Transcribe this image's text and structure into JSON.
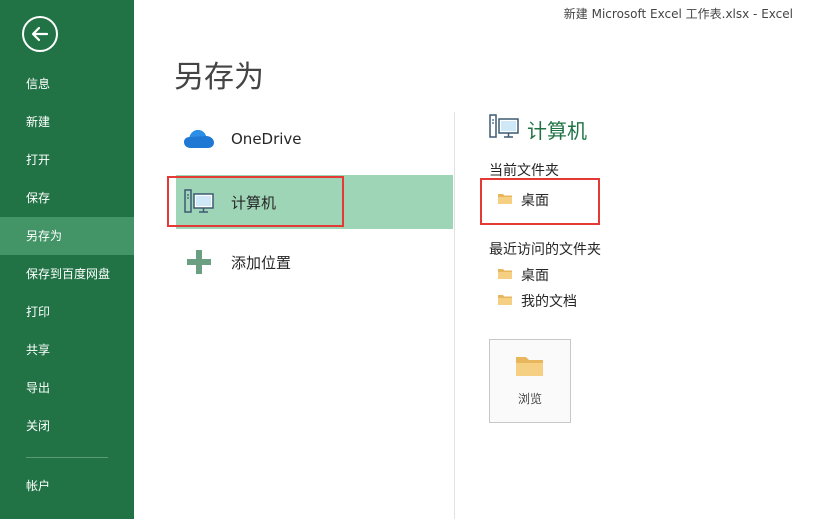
{
  "window": {
    "title": "新建 Microsoft Excel 工作表.xlsx - Excel"
  },
  "sidebar": {
    "back_icon": "back-arrow-icon",
    "items": [
      {
        "label": "信息"
      },
      {
        "label": "新建"
      },
      {
        "label": "打开"
      },
      {
        "label": "保存"
      },
      {
        "label": "另存为",
        "active": true
      },
      {
        "label": "保存到百度网盘"
      },
      {
        "label": "打印"
      },
      {
        "label": "共享"
      },
      {
        "label": "导出"
      },
      {
        "label": "关闭"
      }
    ],
    "account": {
      "label": "帐户"
    }
  },
  "main": {
    "title": "另存为",
    "locations": [
      {
        "label": "OneDrive",
        "icon": "cloud-icon"
      },
      {
        "label": "计算机",
        "icon": "computer-icon",
        "selected": true
      },
      {
        "label": "添加位置",
        "icon": "plus-icon"
      }
    ]
  },
  "right_panel": {
    "heading": "计算机",
    "current_folder_label": "当前文件夹",
    "current_folder": {
      "name": "桌面",
      "icon": "folder-icon"
    },
    "recent_label": "最近访问的文件夹",
    "recent_folders": [
      {
        "name": "桌面",
        "icon": "folder-icon"
      },
      {
        "name": "我的文档",
        "icon": "folder-icon"
      }
    ],
    "browse": {
      "label": "浏览",
      "icon": "folder-icon"
    }
  },
  "colors": {
    "sidebar_bg": "#217346",
    "sidebar_active": "#439467",
    "selected_location": "#9fd5b7",
    "accent_text": "#217346",
    "highlight_box": "#e53935"
  }
}
